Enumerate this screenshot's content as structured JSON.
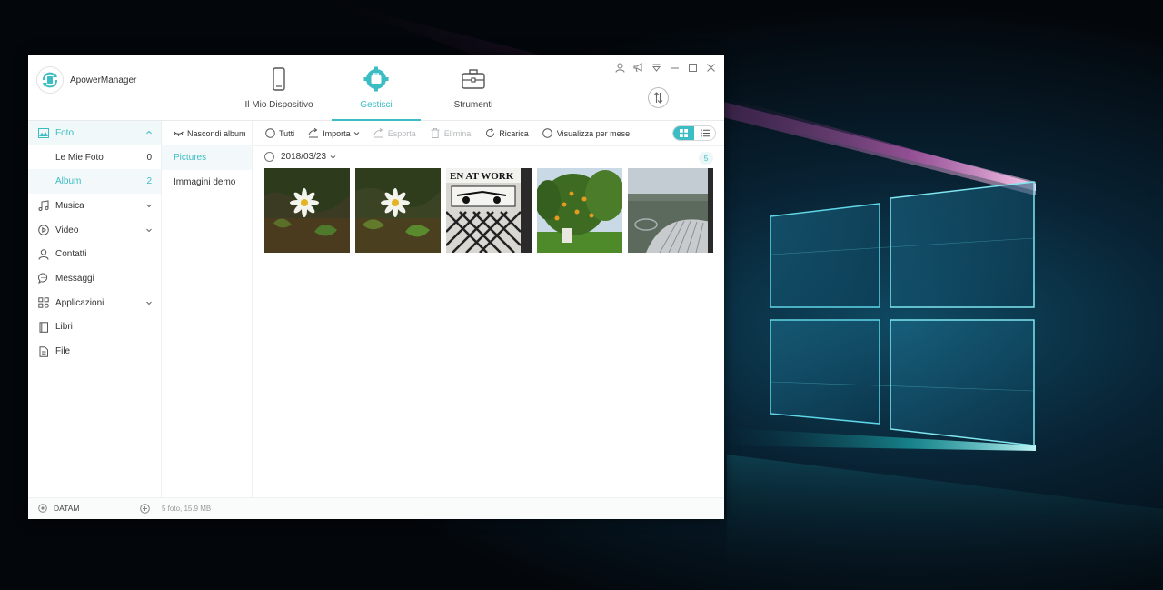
{
  "app": {
    "name": "ApowerManager"
  },
  "nav": {
    "tabs": [
      {
        "label": "Il Mio Dispositivo",
        "icon": "phone-icon"
      },
      {
        "label": "Gestisci",
        "icon": "gear-icon",
        "active": true
      },
      {
        "label": "Strumenti",
        "icon": "toolbox-icon"
      }
    ]
  },
  "window_controls": [
    "user-icon",
    "megaphone-icon",
    "dropdown-menu-icon",
    "minimize-icon",
    "maximize-icon",
    "close-icon"
  ],
  "sidebar": {
    "items": [
      {
        "label": "Foto",
        "icon": "photo-icon",
        "expanded": true
      },
      {
        "label": "Musica",
        "icon": "music-icon"
      },
      {
        "label": "Video",
        "icon": "video-icon"
      },
      {
        "label": "Contatti",
        "icon": "contacts-icon"
      },
      {
        "label": "Messaggi",
        "icon": "messages-icon"
      },
      {
        "label": "Applicazioni",
        "icon": "apps-icon"
      },
      {
        "label": "Libri",
        "icon": "book-icon"
      },
      {
        "label": "File",
        "icon": "file-icon"
      }
    ],
    "sub_items": [
      {
        "label": "Le Mie Foto",
        "count": "0"
      },
      {
        "label": "Album",
        "count": "2",
        "active": true
      }
    ]
  },
  "albums": {
    "hide_label": "Nascondi album",
    "items": [
      {
        "label": "Pictures",
        "active": true
      },
      {
        "label": "Immagini demo"
      }
    ]
  },
  "toolbar": {
    "all": "Tutti",
    "import": "Importa",
    "export": "Esporta",
    "delete": "Elimina",
    "refresh": "Ricarica",
    "by_month": "Visualizza per mese"
  },
  "content": {
    "date": "2018/03/23",
    "count": "5"
  },
  "status": {
    "device": "DATAM",
    "info": "5 foto, 15.9 MB"
  },
  "colors": {
    "accent": "#3cbcc3"
  }
}
